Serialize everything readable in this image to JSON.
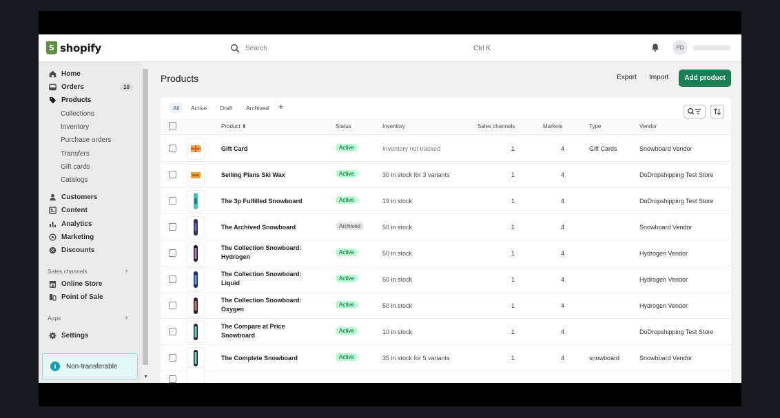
{
  "brand": {
    "name": "shopify",
    "bag_color": "#5e8e3e"
  },
  "search": {
    "placeholder": "Search",
    "shortcut": "Ctrl K"
  },
  "user": {
    "initials": "PD"
  },
  "sidebar": {
    "items": [
      {
        "label": "Home",
        "icon": "home-icon"
      },
      {
        "label": "Orders",
        "icon": "orders-icon",
        "count": "10"
      },
      {
        "label": "Products",
        "icon": "tag-icon"
      }
    ],
    "products_sub": [
      "Collections",
      "Inventory",
      "Purchase orders",
      "Transfers",
      "Gift cards",
      "Catalogs"
    ],
    "items2": [
      {
        "label": "Customers",
        "icon": "person-icon"
      },
      {
        "label": "Content",
        "icon": "content-icon"
      },
      {
        "label": "Analytics",
        "icon": "bar-chart-icon"
      },
      {
        "label": "Marketing",
        "icon": "target-icon"
      },
      {
        "label": "Discounts",
        "icon": "discount-icon"
      }
    ],
    "sales_channels_label": "Sales channels",
    "channels": [
      {
        "label": "Online Store",
        "icon": "store-icon"
      },
      {
        "label": "Point of Sale",
        "icon": "pos-icon"
      }
    ],
    "apps_label": "Apps",
    "settings_label": "Settings",
    "notice": "Non-transferable"
  },
  "page": {
    "title": "Products",
    "export_label": "Export",
    "import_label": "Import",
    "add_label": "Add product",
    "accent": "#1a7f55"
  },
  "tabs": [
    "All",
    "Active",
    "Draft",
    "Archived"
  ],
  "columns": {
    "product": "Product",
    "status": "Status",
    "inventory": "Inventory",
    "sales_channels": "Sales channels",
    "markets": "Markets",
    "type": "Type",
    "vendor": "Vendor"
  },
  "products": [
    {
      "name": "Gift Card",
      "status": "Active",
      "inventory": "Inventory not tracked",
      "sales_channels": "1",
      "markets": "4",
      "type": "Gift Cards",
      "vendor": "Snowboard Vendor"
    },
    {
      "name": "Selling Plans Ski Wax",
      "status": "Active",
      "inventory": "30 in stock for 3 variants",
      "sales_channels": "1",
      "markets": "4",
      "type": "",
      "vendor": "DoDropshipping Test Store"
    },
    {
      "name": "The 3p Fulfilled Snowboard",
      "status": "Active",
      "inventory": "19 in stock",
      "sales_channels": "1",
      "markets": "4",
      "type": "",
      "vendor": "DoDropshipping Test Store"
    },
    {
      "name": "The Archived Snowboard",
      "status": "Archived",
      "inventory": "50 in stock",
      "sales_channels": "1",
      "markets": "4",
      "type": "",
      "vendor": "Snowboard Vendor"
    },
    {
      "name": "The Collection Snowboard: Hydrogen",
      "status": "Active",
      "inventory": "50 in stock",
      "sales_channels": "1",
      "markets": "4",
      "type": "",
      "vendor": "Hydrogen Vendor"
    },
    {
      "name": "The Collection Snowboard: Liquid",
      "status": "Active",
      "inventory": "50 in stock",
      "sales_channels": "1",
      "markets": "4",
      "type": "",
      "vendor": "Hydrogen Vendor"
    },
    {
      "name": "The Collection Snowboard: Oxygen",
      "status": "Active",
      "inventory": "50 in stock",
      "sales_channels": "1",
      "markets": "4",
      "type": "",
      "vendor": "Hydrogen Vendor"
    },
    {
      "name": "The Compare at Price Snowboard",
      "status": "Active",
      "inventory": "10 in stock",
      "sales_channels": "1",
      "markets": "4",
      "type": "",
      "vendor": "DoDropshipping Test Store"
    },
    {
      "name": "The Complete Snowboard",
      "status": "Active",
      "inventory": "35 in stock for 5 variants",
      "sales_channels": "1",
      "markets": "4",
      "type": "snowboard",
      "vendor": "Snowboard Vendor"
    }
  ]
}
